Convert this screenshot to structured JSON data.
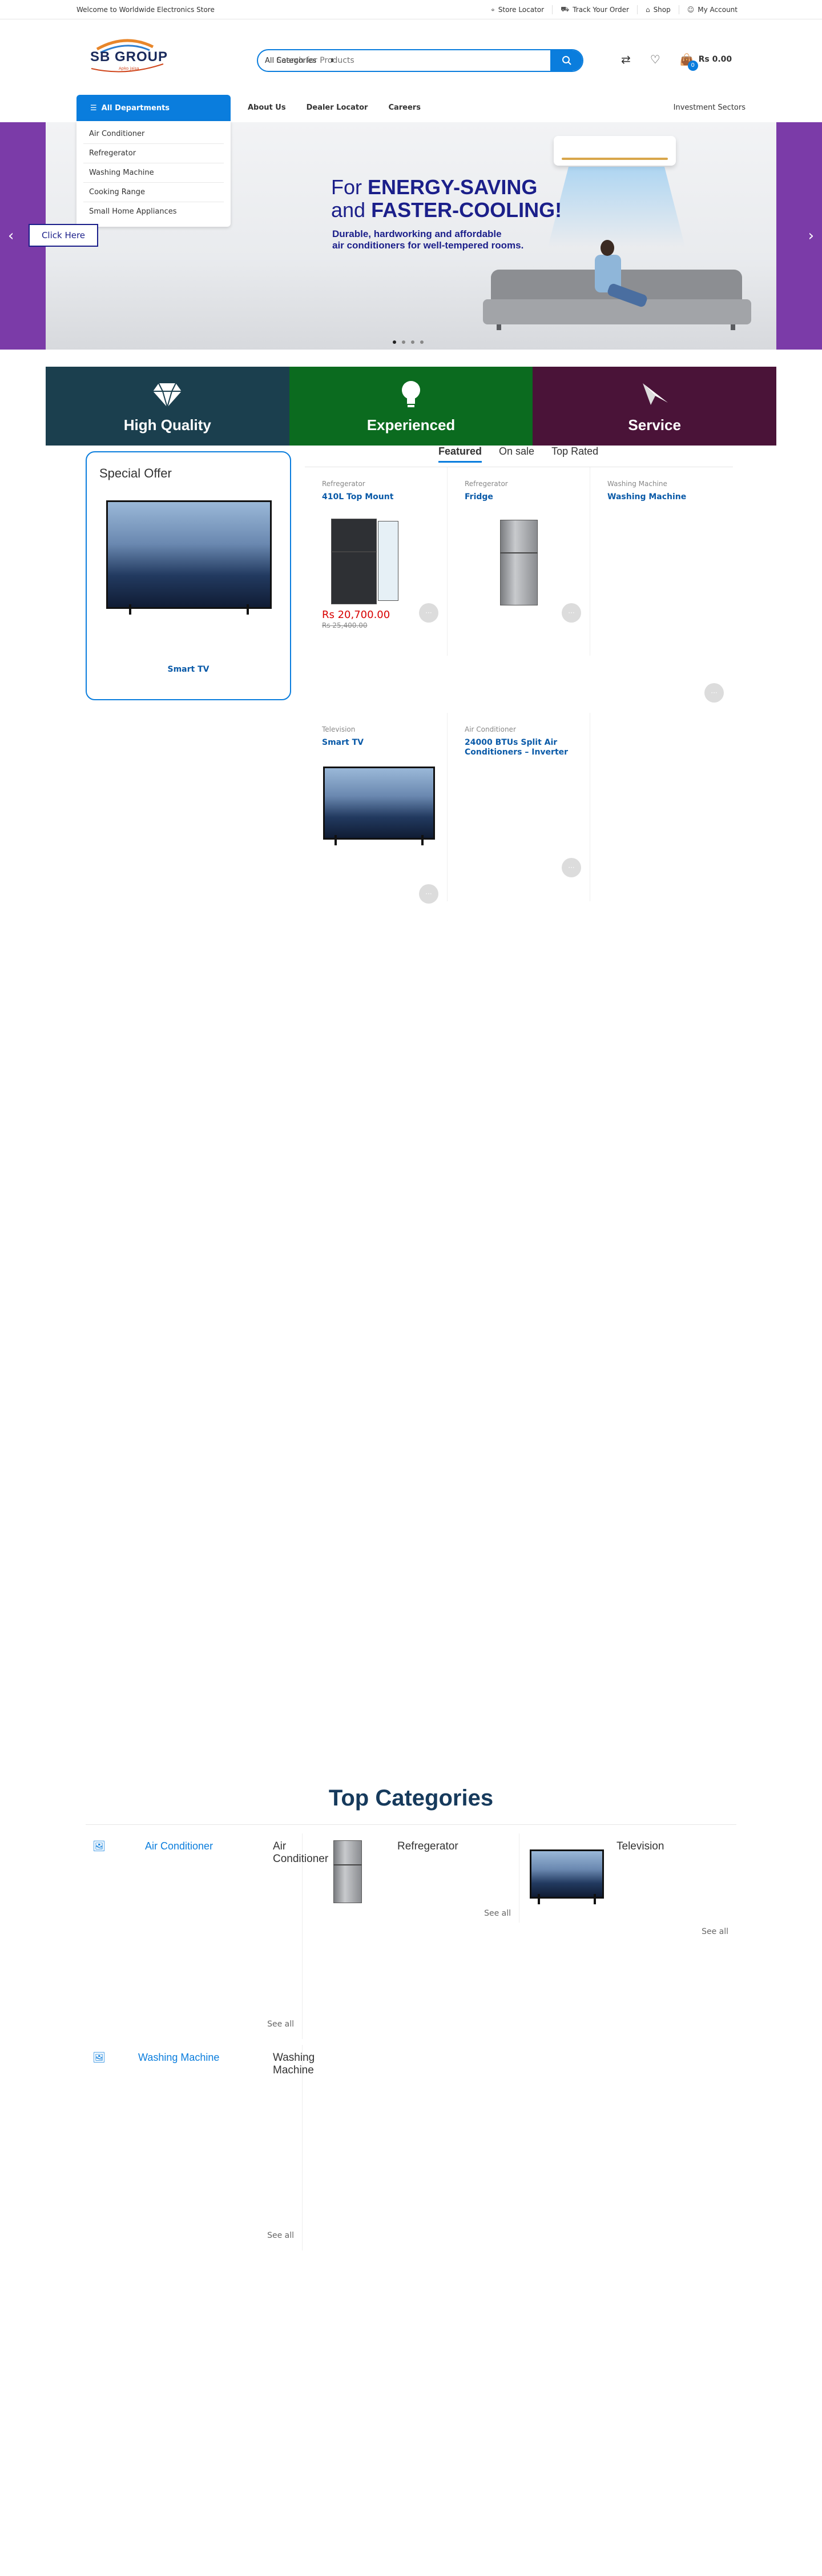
{
  "topbar": {
    "welcome": "Welcome to Worldwide Electronics Store",
    "links": [
      "Store Locator",
      "Track Your Order",
      "Shop",
      "My Account"
    ]
  },
  "header": {
    "logo_text": "SB GROUP",
    "logo_sub": "Apko jaisa",
    "search_placeholder": "Search for Products",
    "category_select": "All Categories",
    "cart_count": "0",
    "cart_total": "Rs 0.00"
  },
  "nav": {
    "departments_label": "All Departments",
    "departments": [
      "Air Conditioner",
      "Refregerator",
      "Washing Machine",
      "Cooking Range",
      "Small Home Appliances"
    ],
    "links": [
      "About Us",
      "Dealer Locator",
      "Careers"
    ],
    "right_link": "Investment Sectors"
  },
  "hero": {
    "cta": "Click Here",
    "heading_line1_plain": "For ",
    "heading_line1_bold": "ENERGY-SAVING",
    "heading_line2_plain": "and ",
    "heading_line2_bold": "FASTER-COOLING!",
    "sub_line1": "Durable, hardworking and affordable",
    "sub_line2": "air conditioners for well-tempered rooms.",
    "active_dot": 0,
    "dot_count": 4
  },
  "features": [
    {
      "label": "High Quality",
      "icon": "diamond-icon",
      "color": "#1b3f4e"
    },
    {
      "label": "Experienced",
      "icon": "lightbulb-icon",
      "color": "#0b6b1f"
    },
    {
      "label": "Service",
      "icon": "paper-plane-icon",
      "color": "#4a1338"
    }
  ],
  "special_offer": {
    "title": "Special Offer",
    "product": "Smart TV"
  },
  "tabs": [
    "Featured",
    "On sale",
    "Top Rated"
  ],
  "products": [
    {
      "category": "Refregerator",
      "name": "410L Top Mount",
      "price": "Rs 20,700.00",
      "old_price": "Rs 25,400.00"
    },
    {
      "category": "Refregerator",
      "name": "Fridge",
      "price": "",
      "old_price": ""
    },
    {
      "category": "Washing Machine",
      "name": "Washing Machine",
      "price": "",
      "old_price": ""
    },
    {
      "category": "Television",
      "name": "Smart TV",
      "price": "",
      "old_price": ""
    },
    {
      "category": "Air Conditioner",
      "name": "24000 BTUs Split Air Conditioners – Inverter",
      "price": "",
      "old_price": ""
    }
  ],
  "add_label": "···",
  "top_categories": {
    "title": "Top Categories",
    "see_all": "See all",
    "items": [
      {
        "name": "Air Conditioner",
        "image_alt": "Air Conditioner"
      },
      {
        "name": "Refregerator",
        "image_alt": ""
      },
      {
        "name": "Television",
        "image_alt": ""
      },
      {
        "name": "Washing Machine",
        "image_alt": "Washing Machine"
      }
    ]
  }
}
